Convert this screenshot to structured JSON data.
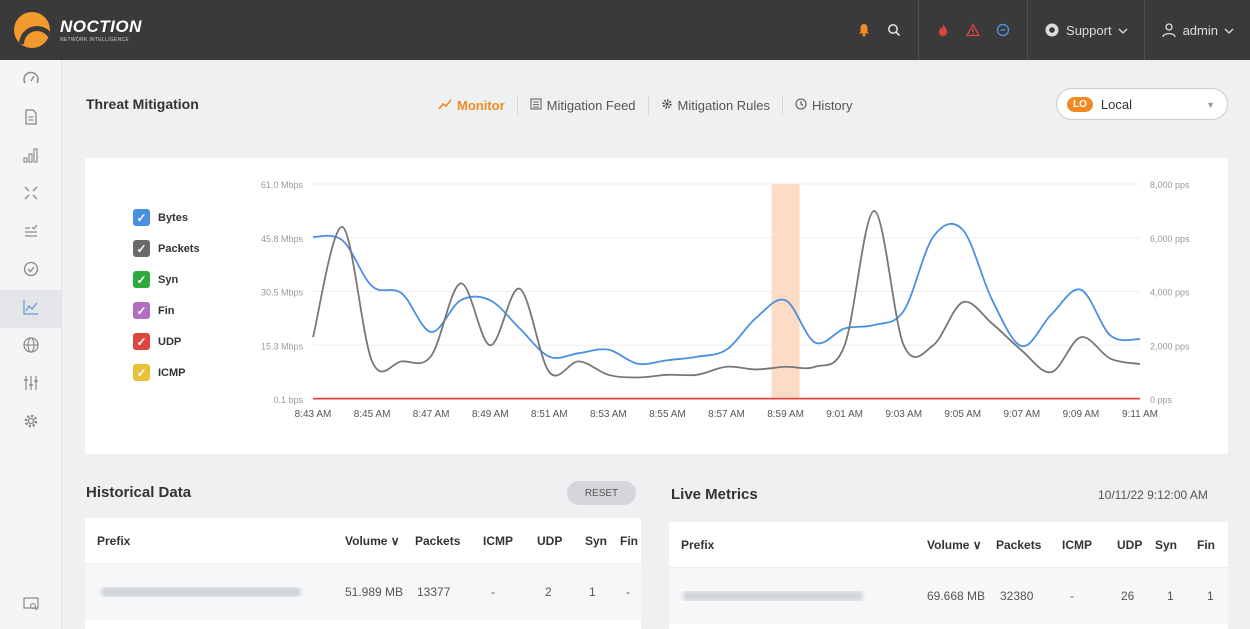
{
  "brand": {
    "name": "NOCTION",
    "tagline": "NETWORK INTELLIGENCE"
  },
  "topbar": {
    "support_label": "Support",
    "user_label": "admin",
    "icons": [
      "bell-icon",
      "search-icon",
      "fire-icon",
      "warning-icon",
      "chat-icon",
      "support-icon",
      "user-icon"
    ]
  },
  "sidebar": {
    "items": [
      {
        "icon": "dashboard-icon"
      },
      {
        "icon": "report-icon"
      },
      {
        "icon": "bar-chart-icon"
      },
      {
        "icon": "compress-icon"
      },
      {
        "icon": "list-check-icon"
      },
      {
        "icon": "check-circle-icon"
      },
      {
        "icon": "line-chart-icon",
        "active": true
      },
      {
        "icon": "globe-icon"
      },
      {
        "icon": "sliders-icon"
      },
      {
        "icon": "gear-icon"
      }
    ],
    "bottom_icon": "screen-search-icon"
  },
  "page": {
    "title": "Threat Mitigation"
  },
  "tabs": [
    {
      "label": "Monitor",
      "icon": "trend-icon",
      "active": true
    },
    {
      "label": "Mitigation Feed",
      "icon": "feed-icon"
    },
    {
      "label": "Mitigation Rules",
      "icon": "gear-icon"
    },
    {
      "label": "History",
      "icon": "clock-icon"
    }
  ],
  "router_select": {
    "badge": "LO",
    "value": "Local"
  },
  "legend": [
    {
      "label": "Bytes",
      "color": "#4a90e2",
      "checked": true
    },
    {
      "label": "Packets",
      "color": "#6b6b6b",
      "checked": true
    },
    {
      "label": "Syn",
      "color": "#2eaa3f",
      "checked": true
    },
    {
      "label": "Fin",
      "color": "#b36cc4",
      "checked": true
    },
    {
      "label": "UDP",
      "color": "#e0443e",
      "checked": true
    },
    {
      "label": "ICMP",
      "color": "#e8c33a",
      "checked": true
    }
  ],
  "chart_data": {
    "type": "line",
    "categories": [
      "8:43 AM",
      "8:45 AM",
      "8:47 AM",
      "8:49 AM",
      "8:51 AM",
      "8:53 AM",
      "8:55 AM",
      "8:57 AM",
      "8:59 AM",
      "9:01 AM",
      "9:03 AM",
      "9:05 AM",
      "9:07 AM",
      "9:09 AM",
      "9:11 AM"
    ],
    "y_left_ticks": [
      "61.0 Mbps",
      "45.8 Mbps",
      "30.5 Mbps",
      "15.3 Mbps",
      "0.1 bps"
    ],
    "y_right_ticks": [
      "8,000 pps",
      "6,000 pps",
      "4,000 pps",
      "2,000 pps",
      "0 pps"
    ],
    "ylim_left": [
      0,
      61.0
    ],
    "ylim_right": [
      0,
      8000
    ],
    "highlight_range": [
      "8:59 AM",
      "8:59 AM"
    ],
    "series": [
      {
        "name": "Bytes",
        "axis": "left",
        "color": "#4a90e2",
        "x": [
          0,
          1,
          2,
          3,
          4,
          5,
          6,
          7,
          8,
          9,
          10,
          11,
          12,
          13,
          14,
          15,
          16,
          17,
          18,
          19,
          20,
          21,
          22,
          23,
          24,
          25,
          26,
          27,
          28
        ],
        "values": [
          46,
          45,
          32,
          30,
          19,
          28,
          28,
          20,
          12,
          13,
          14,
          10,
          11,
          12,
          14,
          23,
          28,
          16,
          20,
          21,
          25,
          46,
          48,
          28,
          15,
          24,
          31,
          18,
          17
        ]
      },
      {
        "name": "Packets",
        "axis": "right",
        "color": "#777777",
        "x": [
          0,
          1,
          2,
          3,
          4,
          5,
          6,
          7,
          8,
          9,
          10,
          11,
          12,
          13,
          14,
          15,
          16,
          17,
          18,
          19,
          20,
          21,
          22,
          23,
          24,
          25,
          26,
          27,
          28
        ],
        "values": [
          2300,
          6400,
          1400,
          1400,
          1600,
          4300,
          2000,
          4100,
          1000,
          1400,
          900,
          800,
          900,
          900,
          1200,
          1100,
          1200,
          1200,
          2000,
          7000,
          2000,
          2000,
          3600,
          2800,
          1800,
          1000,
          2300,
          1500,
          1300
        ]
      },
      {
        "name": "UDP",
        "axis": "left",
        "color": "#e0443e",
        "x": [
          0,
          28
        ],
        "values": [
          0.1,
          0.1
        ]
      }
    ]
  },
  "historical": {
    "title": "Historical Data",
    "reset_label": "RESET",
    "columns": [
      "Prefix",
      "Volume ∨",
      "Packets",
      "ICMP",
      "UDP",
      "Syn",
      "Fin"
    ],
    "rows": [
      {
        "volume": "51.989 MB",
        "packets": "13377",
        "icmp": "-",
        "udp": "2",
        "syn": "1",
        "fin": "-"
      }
    ]
  },
  "live": {
    "title": "Live Metrics",
    "timestamp": "10/11/22 9:12:00 AM",
    "columns": [
      "Prefix",
      "Volume ∨",
      "Packets",
      "ICMP",
      "UDP",
      "Syn",
      "Fin"
    ],
    "rows": [
      {
        "volume": "69.668 MB",
        "packets": "32380",
        "icmp": "-",
        "udp": "26",
        "syn": "1",
        "fin": "1"
      }
    ]
  }
}
